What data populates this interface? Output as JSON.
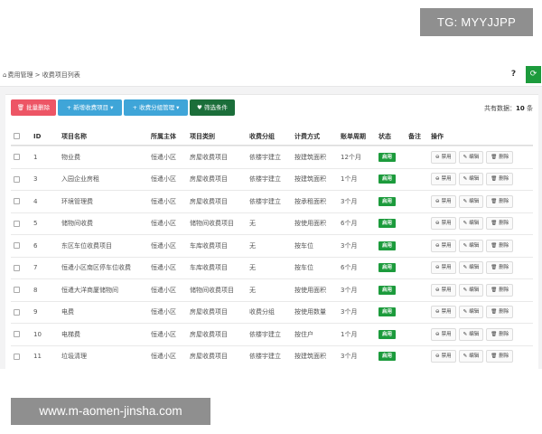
{
  "watermarks": {
    "top": "TG: MYYJJPP",
    "bottom": "www.m-aomen-jinsha.com"
  },
  "breadcrumb": "费用管理 > 收费项目列表",
  "toolbar": {
    "batch_delete": "批量删除",
    "add_item": "新增收费项目",
    "group_manage": "收费分组管理",
    "filter": "筛选条件"
  },
  "total": {
    "label": "共有数据：",
    "count": "10",
    "unit": "条"
  },
  "columns": {
    "id": "ID",
    "name": "项目名称",
    "owner": "所属主体",
    "category": "项目类别",
    "group": "收费分组",
    "mode": "计费方式",
    "period": "账单周期",
    "state": "状态",
    "note": "备注",
    "action": "操作"
  },
  "actions": {
    "disable": "禁用",
    "edit": "编辑",
    "delete": "删除"
  },
  "rows": [
    {
      "id": "1",
      "name": "物业费",
      "owner": "恒遣小区",
      "category": "房屋收费项目",
      "group": "依楼宇建立",
      "mode": "按建筑面积",
      "period": "12个月",
      "state": "启用"
    },
    {
      "id": "3",
      "name": "入园企业房租",
      "owner": "恒遣小区",
      "category": "房屋收费项目",
      "group": "依楼宇建立",
      "mode": "按建筑面积",
      "period": "1个月",
      "state": "启用"
    },
    {
      "id": "4",
      "name": "环境管理费",
      "owner": "恒遣小区",
      "category": "房屋收费项目",
      "group": "依楼宇建立",
      "mode": "按承租面积",
      "period": "3个月",
      "state": "启用"
    },
    {
      "id": "5",
      "name": "储物间收费",
      "owner": "恒遣小区",
      "category": "储物间收费项目",
      "group": "无",
      "mode": "按使用面积",
      "period": "6个月",
      "state": "启用"
    },
    {
      "id": "6",
      "name": "东区车位收费项目",
      "owner": "恒遣小区",
      "category": "车库收费项目",
      "group": "无",
      "mode": "按车位",
      "period": "3个月",
      "state": "启用"
    },
    {
      "id": "7",
      "name": "恒遣小区南区停车位收费",
      "owner": "恒遣小区",
      "category": "车库收费项目",
      "group": "无",
      "mode": "按车位",
      "period": "6个月",
      "state": "启用"
    },
    {
      "id": "8",
      "name": "恒遣大洋商厦储物间",
      "owner": "恒遣小区",
      "category": "储物间收费项目",
      "group": "无",
      "mode": "按使用面积",
      "period": "3个月",
      "state": "启用"
    },
    {
      "id": "9",
      "name": "电费",
      "owner": "恒遣小区",
      "category": "房屋收费项目",
      "group": "收费分组",
      "mode": "按使用数量",
      "period": "3个月",
      "state": "启用"
    },
    {
      "id": "10",
      "name": "电梯费",
      "owner": "恒遣小区",
      "category": "房屋收费项目",
      "group": "依楼宇建立",
      "mode": "按住户",
      "period": "1个月",
      "state": "启用"
    },
    {
      "id": "11",
      "name": "垃圾清理",
      "owner": "恒遣小区",
      "category": "房屋收费项目",
      "group": "依楼宇建立",
      "mode": "按建筑面积",
      "period": "3个月",
      "state": "启用"
    }
  ],
  "colors": {
    "accent": "#1c9b3c",
    "danger": "#ed5565",
    "info": "#3fa5d8",
    "filter": "#1b6e3a"
  }
}
